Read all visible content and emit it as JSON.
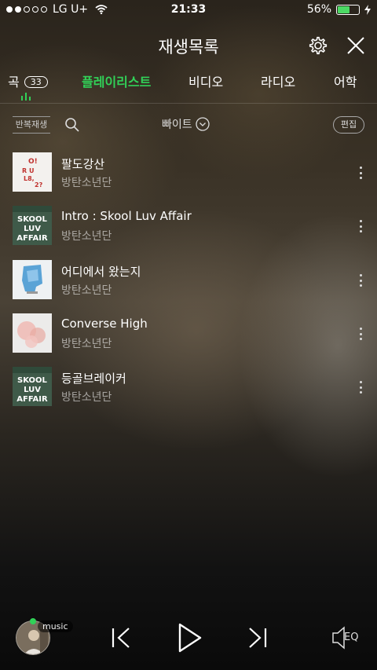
{
  "status_bar": {
    "carrier": "LG U+",
    "time": "21:33",
    "battery": "56%",
    "battery_level": 0.56,
    "battery_color": "#4cd964"
  },
  "header": {
    "title": "재생목록",
    "settings_icon": "gear-icon",
    "close_icon": "close-icon"
  },
  "tabs": [
    {
      "label": "곡",
      "count": "33",
      "active": false
    },
    {
      "label": "플레이리스트",
      "active": true
    },
    {
      "label": "비디오",
      "active": false
    },
    {
      "label": "라디오",
      "active": false
    },
    {
      "label": "어학",
      "active": false
    }
  ],
  "toolbar": {
    "repeat_label": "반복재생",
    "sort_label": "빠이트",
    "edit_label": "편집"
  },
  "songs": [
    {
      "title": "팔도강산",
      "artist": "방탄소년단"
    },
    {
      "title": "Intro : Skool Luv Affair",
      "artist": "방탄소년단"
    },
    {
      "title": "어디에서 왔는지",
      "artist": "방탄소년단"
    },
    {
      "title": "Converse High",
      "artist": "방탄소년단"
    },
    {
      "title": "등골브레이커",
      "artist": "방탄소년단"
    }
  ],
  "album_art": {
    "orul82_lines": [
      "O!",
      "R U",
      "L8,",
      "2?"
    ],
    "skool_lines": [
      "SKOOL",
      "LUV",
      "AFFAIR"
    ]
  },
  "player": {
    "music_tag": "music",
    "eq_label": "EQ"
  },
  "colors": {
    "accent": "#31d158"
  }
}
